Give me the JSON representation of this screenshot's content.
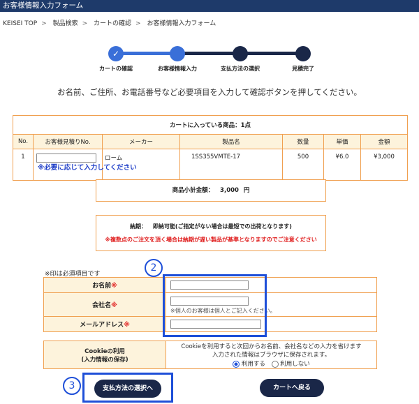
{
  "header": {
    "title": "お客様情報入力フォーム"
  },
  "breadcrumb": [
    "KEISEI TOP",
    "製品検索",
    "カートの確認",
    "お客様情報入力フォーム"
  ],
  "steps": [
    "カートの確認",
    "お客様情報入力",
    "支払方法の選択",
    "見積完了"
  ],
  "intro": "お名前、ご住所、お電話番号など必要項目を入力して確認ボタンを押してください。",
  "cart": {
    "caption": "カートに入っている商品：1点",
    "headers": [
      "No.",
      "お客様見積りNo.",
      "メーカー",
      "製品名",
      "数量",
      "単価",
      "金額"
    ],
    "row": {
      "no": "1",
      "maker": "ローム",
      "product": "1SS355VMTE-17",
      "qty": "500",
      "unit": "¥6.0",
      "amount": "¥3,000"
    },
    "note": "※必要に応じて入力してください"
  },
  "subtotal": {
    "label": "商品小計金額：",
    "value": "3,000",
    "unit": "円"
  },
  "delivery": {
    "label": "納期：",
    "text": "即納可能(ご指定がない場合は最短での出荷となります)",
    "warning": "※複数点のご注文を頂く場合は納期が遅い製品が基準となりますのでご注意ください"
  },
  "form": {
    "required_note": "※印は必須項目です",
    "name_label": "お名前",
    "company_label": "会社名",
    "company_note": "※個人のお客様は個人とご記入ください。",
    "email_label": "メールアドレス",
    "req_mark": "※"
  },
  "cookie": {
    "label1": "Cookieの利用",
    "label2": "(入力情報の保存)",
    "text1": "Cookieを利用すると次回からお名前、会社名などの入力を省けます",
    "text2": "入力された情報はブラウザに保存されます。",
    "opt_yes": "利用する",
    "opt_no": "利用しない"
  },
  "buttons": {
    "payment": "支払方法の選択へ",
    "back": "カートへ戻る"
  },
  "markers": {
    "two": "2",
    "three": "3"
  },
  "colors": {
    "header": "#1e3a6a",
    "accent_blue": "#1e4fd8",
    "step_done": "#3a6fd8",
    "step_todo": "#1a2748",
    "border": "#f0a050",
    "required": "#e02020"
  }
}
